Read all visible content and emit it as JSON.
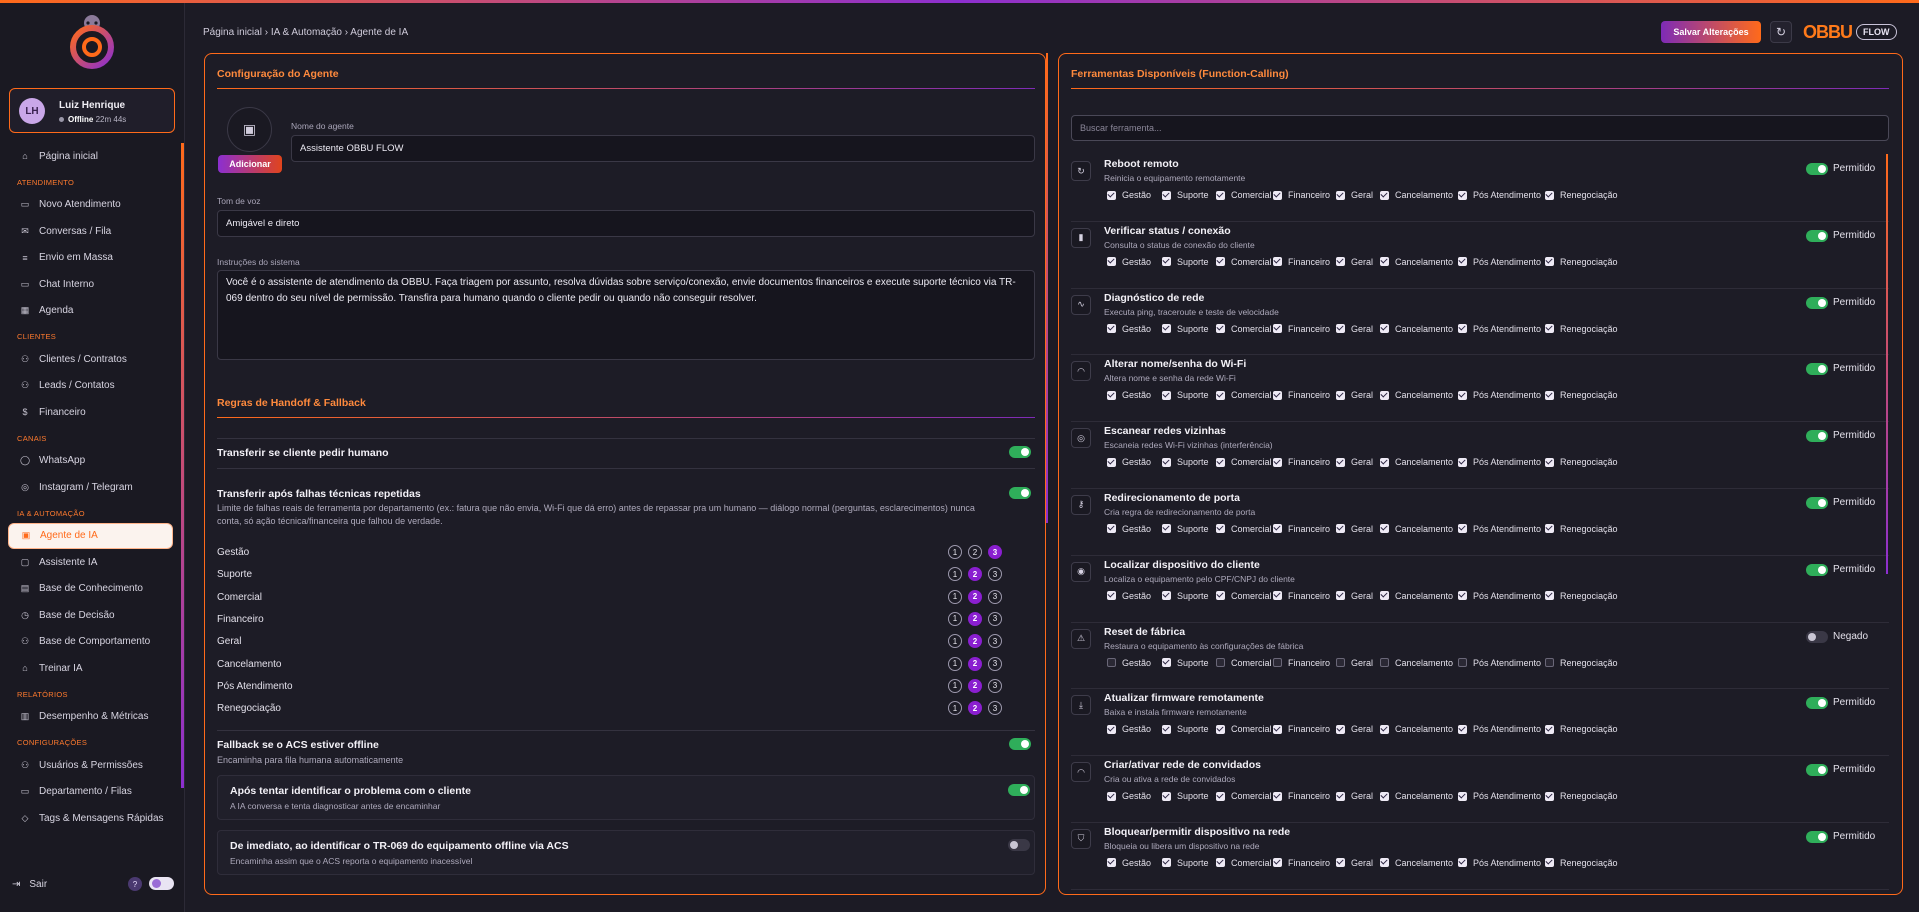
{
  "breadcrumb": "Página inicial › IA & Automação › Agente de IA",
  "header": {
    "save_label": "Salvar Alterações",
    "brand": "OBBU",
    "brand_tag": "FLOW"
  },
  "user": {
    "initials": "LH",
    "name": "Luiz Henrique",
    "status": "Offline",
    "time": "22m 44s"
  },
  "nav": {
    "home": "Página inicial",
    "sections": [
      {
        "title": "ATENDIMENTO",
        "items": [
          "Novo Atendimento",
          "Conversas / Fila",
          "Envio em Massa",
          "Chat Interno",
          "Agenda"
        ]
      },
      {
        "title": "CLIENTES",
        "items": [
          "Clientes / Contratos",
          "Leads / Contatos",
          "Financeiro"
        ]
      },
      {
        "title": "CANAIS",
        "items": [
          "WhatsApp",
          "Instagram / Telegram"
        ]
      },
      {
        "title": "IA & AUTOMAÇÃO",
        "items": [
          "Agente de IA",
          "Assistente IA",
          "Base de Conhecimento",
          "Base de Decisão",
          "Base de Comportamento",
          "Treinar IA"
        ]
      },
      {
        "title": "RELATÓRIOS",
        "items": [
          "Desempenho & Métricas"
        ]
      },
      {
        "title": "CONFIGURAÇÕES",
        "items": [
          "Usuários & Permissões",
          "Departamento / Filas",
          "Tags & Mensagens Rápidas"
        ]
      }
    ],
    "active": "Agente de IA",
    "logout": "Sair",
    "help": "?"
  },
  "agent": {
    "title": "Configuração do Agente",
    "add_label": "Adicionar",
    "name_label": "Nome do agente",
    "name_value": "Assistente OBBU FLOW",
    "tone_label": "Tom de voz",
    "tone_value": "Amigável e direto",
    "instructions_label": "Instruções do sistema",
    "instructions_value": "Você é o assistente de atendimento da OBBU. Faça triagem por assunto, resolva dúvidas sobre serviço/conexão, envie documentos financeiros e execute suporte técnico via TR-069 dentro do seu nível de permissão. Transfira para humano quando o cliente pedir ou quando não conseguir resolver."
  },
  "handoff": {
    "title": "Regras de Handoff & Fallback",
    "rule1": {
      "title": "Transferir se cliente pedir humano",
      "enabled": true
    },
    "rule2": {
      "title": "Transferir após falhas técnicas repetidas",
      "desc": "Limite de falhas reais de ferramenta por departamento (ex.: fatura que não envia, Wi-Fi que dá erro) antes de repassar pra um humano — diálogo normal (perguntas, esclarecimentos) nunca conta, só ação técnica/financeira que falhou de verdade.",
      "enabled": true,
      "departments": [
        {
          "name": "Gestão",
          "level": 3
        },
        {
          "name": "Suporte",
          "level": 2
        },
        {
          "name": "Comercial",
          "level": 2
        },
        {
          "name": "Financeiro",
          "level": 2
        },
        {
          "name": "Geral",
          "level": 2
        },
        {
          "name": "Cancelamento",
          "level": 2
        },
        {
          "name": "Pós Atendimento",
          "level": 2
        },
        {
          "name": "Renegociação",
          "level": 2
        }
      ]
    },
    "rule3": {
      "title": "Fallback se o ACS estiver offline",
      "desc": "Encaminha para fila humana automaticamente",
      "enabled": true
    },
    "option1": {
      "title": "Após tentar identificar o problema com o cliente",
      "desc": "A IA conversa e tenta diagnosticar antes de encaminhar",
      "enabled": true
    },
    "option2": {
      "title": "De imediato, ao identificar o TR-069 do equipamento offline via ACS",
      "desc": "Encaminha assim que o ACS reporta o equipamento inacessível",
      "enabled": false
    }
  },
  "tools": {
    "title": "Ferramentas Disponíveis (Function-Calling)",
    "search_placeholder": "Buscar ferramenta...",
    "perm_labels": [
      "Gestão",
      "Suporte",
      "Comercial",
      "Financeiro",
      "Geral",
      "Cancelamento",
      "Pós Atendimento",
      "Renegociação"
    ],
    "allowed_label": "Permitido",
    "denied_label": "Negado",
    "items": [
      {
        "name": "Reboot remoto",
        "desc": "Reinicia o equipamento remotamente",
        "icon": "refresh-icon",
        "allowed": true,
        "status": "Permitido",
        "perms": [
          true,
          true,
          true,
          true,
          true,
          true,
          true,
          true
        ]
      },
      {
        "name": "Verificar status / conexão",
        "desc": "Consulta o status de conexão do cliente",
        "icon": "signal-bars-icon",
        "allowed": true,
        "status": "Permitido",
        "perms": [
          true,
          true,
          true,
          true,
          true,
          true,
          true,
          true
        ]
      },
      {
        "name": "Diagnóstico de rede",
        "desc": "Executa ping, traceroute e teste de velocidade",
        "icon": "pulse-icon",
        "allowed": true,
        "status": "Permitido",
        "perms": [
          true,
          true,
          true,
          true,
          true,
          true,
          true,
          true
        ]
      },
      {
        "name": "Alterar nome/senha do Wi-Fi",
        "desc": "Altera nome e senha da rede Wi-Fi",
        "icon": "wifi-icon",
        "allowed": true,
        "status": "Permitido",
        "perms": [
          true,
          true,
          true,
          true,
          true,
          true,
          true,
          true
        ]
      },
      {
        "name": "Escanear redes vizinhas",
        "desc": "Escaneia redes Wi-Fi vizinhas (interferência)",
        "icon": "radar-icon",
        "allowed": true,
        "status": "Permitido",
        "perms": [
          true,
          true,
          true,
          true,
          true,
          true,
          true,
          true
        ]
      },
      {
        "name": "Redirecionamento de porta",
        "desc": "Cria regra de redirecionamento de porta",
        "icon": "key-icon",
        "allowed": true,
        "status": "Permitido",
        "perms": [
          true,
          true,
          true,
          true,
          true,
          true,
          true,
          true
        ]
      },
      {
        "name": "Localizar dispositivo do cliente",
        "desc": "Localiza o equipamento pelo CPF/CNPJ do cliente",
        "icon": "map-pin-icon",
        "allowed": true,
        "status": "Permitido",
        "perms": [
          true,
          true,
          true,
          true,
          true,
          true,
          true,
          true
        ]
      },
      {
        "name": "Reset de fábrica",
        "desc": "Restaura o equipamento às configurações de fábrica",
        "icon": "warning-icon",
        "allowed": false,
        "status": "Negado",
        "perms": [
          false,
          true,
          false,
          false,
          false,
          false,
          false,
          false
        ]
      },
      {
        "name": "Atualizar firmware remotamente",
        "desc": "Baixa e instala firmware remotamente",
        "icon": "download-icon",
        "allowed": true,
        "status": "Permitido",
        "perms": [
          true,
          true,
          true,
          true,
          true,
          true,
          true,
          true
        ]
      },
      {
        "name": "Criar/ativar rede de convidados",
        "desc": "Cria ou ativa a rede de convidados",
        "icon": "wifi-icon",
        "allowed": true,
        "status": "Permitido",
        "perms": [
          true,
          true,
          true,
          true,
          true,
          true,
          true,
          true
        ]
      },
      {
        "name": "Bloquear/permitir dispositivo na rede",
        "desc": "Bloqueia ou libera um dispositivo na rede",
        "icon": "shield-icon",
        "allowed": true,
        "status": "Permitido",
        "perms": [
          true,
          true,
          true,
          true,
          true,
          true,
          true,
          true
        ]
      }
    ]
  },
  "colors": {
    "accent": "#ff6a1a",
    "purple": "#8c2fd0",
    "success": "#2fae5a",
    "panel": "#1d1c26",
    "bg": "#1c1b25"
  }
}
